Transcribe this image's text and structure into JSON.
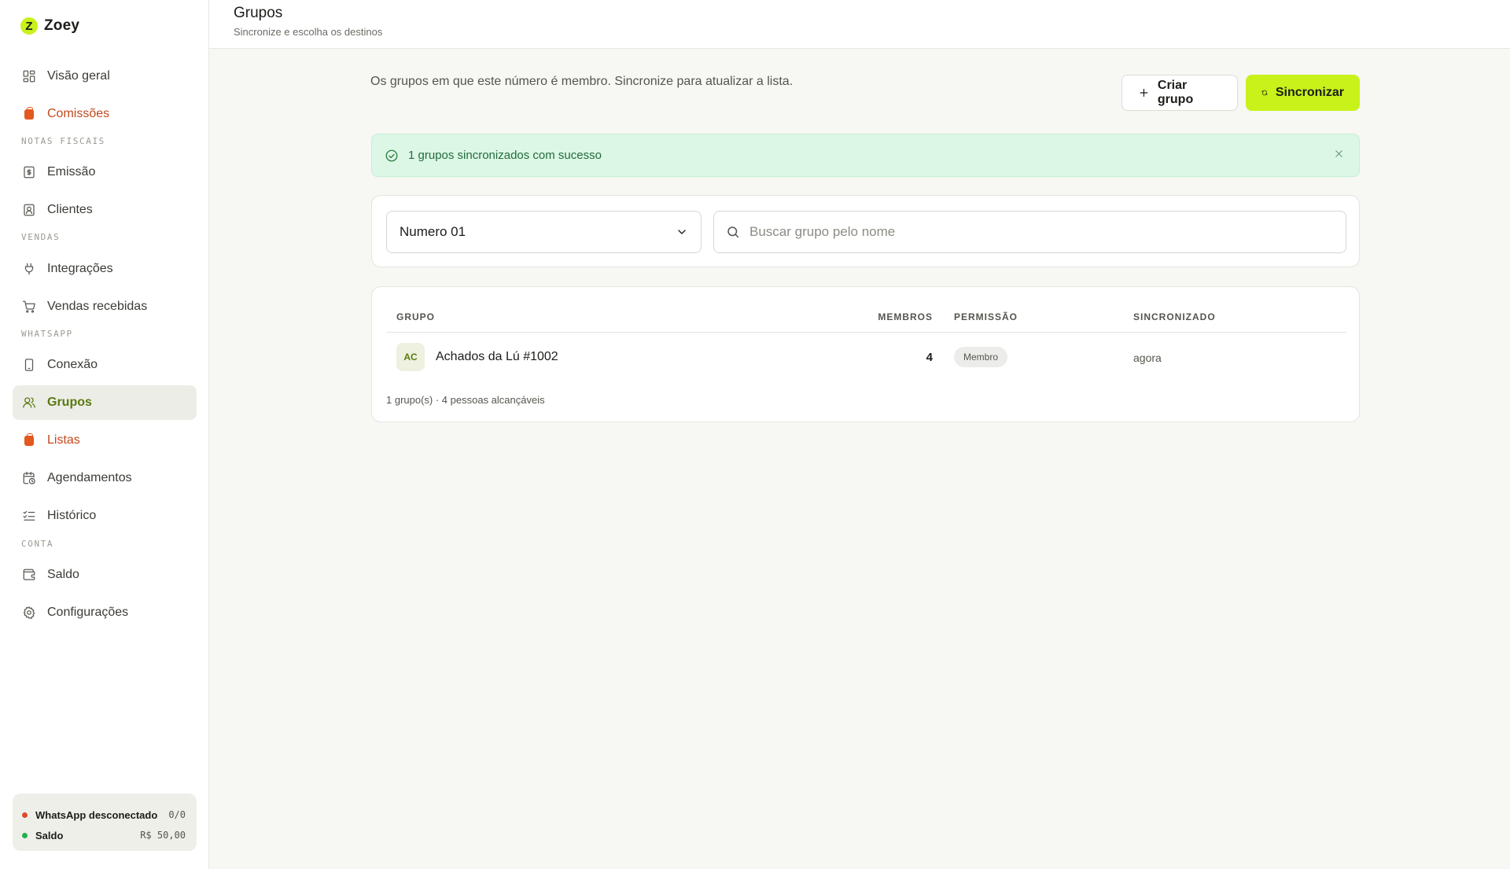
{
  "brand": {
    "logo_letter": "Z",
    "name": "Zoey"
  },
  "sidebar": {
    "items": [
      {
        "key": "overview",
        "label": "Visão geral",
        "icon": "grid-icon"
      },
      {
        "key": "commissions",
        "label": "Comissões",
        "icon": "shopping-bag-icon"
      },
      {
        "key": "emission",
        "label": "Emissão",
        "icon": "dollar-receipt-icon"
      },
      {
        "key": "clients",
        "label": "Clientes",
        "icon": "contact-card-icon"
      },
      {
        "key": "integrations",
        "label": "Integrações",
        "icon": "plug-icon"
      },
      {
        "key": "sales",
        "label": "Vendas recebidas",
        "icon": "shopping-cart-icon"
      },
      {
        "key": "connection",
        "label": "Conexão",
        "icon": "smartphone-icon"
      },
      {
        "key": "groups",
        "label": "Grupos",
        "icon": "users-icon"
      },
      {
        "key": "lists",
        "label": "Listas",
        "icon": "shopping-bag-icon"
      },
      {
        "key": "schedules",
        "label": "Agendamentos",
        "icon": "calendar-clock-icon"
      },
      {
        "key": "history",
        "label": "Histórico",
        "icon": "list-checks-icon"
      },
      {
        "key": "balance",
        "label": "Saldo",
        "icon": "wallet-icon"
      },
      {
        "key": "settings",
        "label": "Configurações",
        "icon": "gear-icon"
      }
    ],
    "sections": {
      "invoices": "NOTAS FISCAIS",
      "sales": "VENDAS",
      "whatsapp": "WHATSAPP",
      "account": "CONTA"
    },
    "active": "Grupos",
    "status": {
      "whatsapp": {
        "label": "WhatsApp desconectado",
        "value": "0/0",
        "color": "#e0482b"
      },
      "balance": {
        "label": "Saldo",
        "value": "R$ 50,00",
        "color": "#22b04e"
      }
    }
  },
  "header": {
    "title": "Grupos",
    "subtitle": "Sincronize e escolha os destinos"
  },
  "main": {
    "intro": "Os grupos em que este número é membro. Sincronize para atualizar a lista.",
    "create_button": "Criar grupo",
    "sync_button": "Sincronizar",
    "alert": "1 grupos sincronizados com sucesso",
    "number_select": {
      "value": "Numero 01"
    },
    "search": {
      "placeholder": "Buscar grupo pelo nome",
      "value": ""
    },
    "table": {
      "columns": [
        "GRUPO",
        "MEMBROS",
        "PERMISSÃO",
        "SINCRONIZADO"
      ],
      "rows": [
        {
          "initials": "AC",
          "name": "Achados da Lú #1002",
          "members": "4",
          "permission": "Membro",
          "synced": "agora"
        }
      ],
      "footer": "1 grupo(s) · 4 pessoas alcançáveis"
    }
  },
  "colors": {
    "accent": "#c8f21a",
    "active_text": "#5a7a10",
    "commission_text": "#c2491d",
    "alert_bg": "#dcf7e6",
    "alert_text": "#236b3a"
  }
}
